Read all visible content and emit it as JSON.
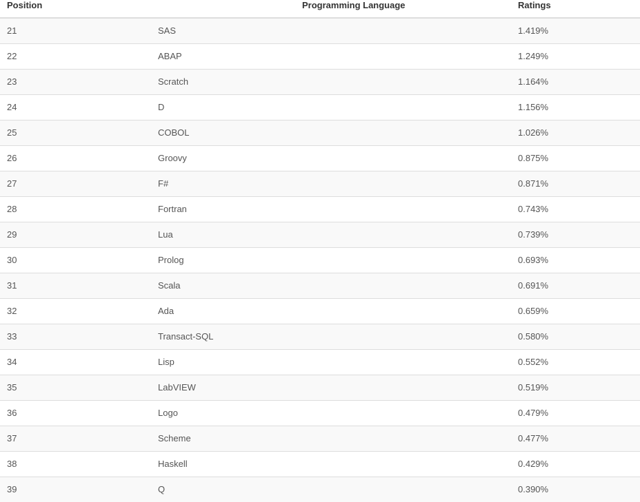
{
  "table": {
    "columns": [
      {
        "key": "position",
        "label": "Position"
      },
      {
        "key": "language",
        "label": "Programming Language"
      },
      {
        "key": "rating",
        "label": "Ratings"
      }
    ],
    "rows": [
      {
        "position": "21",
        "language": "SAS",
        "rating": "1.419%"
      },
      {
        "position": "22",
        "language": "ABAP",
        "rating": "1.249%"
      },
      {
        "position": "23",
        "language": "Scratch",
        "rating": "1.164%"
      },
      {
        "position": "24",
        "language": "D",
        "rating": "1.156%"
      },
      {
        "position": "25",
        "language": "COBOL",
        "rating": "1.026%"
      },
      {
        "position": "26",
        "language": "Groovy",
        "rating": "0.875%"
      },
      {
        "position": "27",
        "language": "F#",
        "rating": "0.871%"
      },
      {
        "position": "28",
        "language": "Fortran",
        "rating": "0.743%"
      },
      {
        "position": "29",
        "language": "Lua",
        "rating": "0.739%"
      },
      {
        "position": "30",
        "language": "Prolog",
        "rating": "0.693%"
      },
      {
        "position": "31",
        "language": "Scala",
        "rating": "0.691%"
      },
      {
        "position": "32",
        "language": "Ada",
        "rating": "0.659%"
      },
      {
        "position": "33",
        "language": "Transact-SQL",
        "rating": "0.580%"
      },
      {
        "position": "34",
        "language": "Lisp",
        "rating": "0.552%"
      },
      {
        "position": "35",
        "language": "LabVIEW",
        "rating": "0.519%"
      },
      {
        "position": "36",
        "language": "Logo",
        "rating": "0.479%"
      },
      {
        "position": "37",
        "language": "Scheme",
        "rating": "0.477%"
      },
      {
        "position": "38",
        "language": "Haskell",
        "rating": "0.429%"
      },
      {
        "position": "39",
        "language": "Q",
        "rating": "0.390%"
      }
    ]
  },
  "colors": {
    "header_text": "#333333",
    "body_text": "#555555",
    "row_alt_background": "#f9f9f9",
    "row_background": "#ffffff",
    "border": "#dddddd"
  }
}
